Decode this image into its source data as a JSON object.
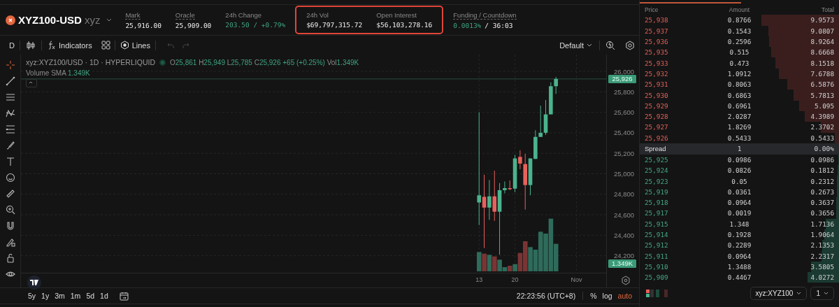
{
  "header": {
    "symbol": "XYZ100-USD",
    "dex": "xyz",
    "groups": [
      {
        "boxed": false,
        "stats": [
          {
            "label": "Mark",
            "value": "25,916.00",
            "underlined": true,
            "positive": false
          },
          {
            "label": "Oracle",
            "value": "25,909.00",
            "underlined": true,
            "positive": false
          },
          {
            "label": "24h Change",
            "value": "203.50 / +0.79%",
            "underlined": false,
            "positive": true
          }
        ]
      },
      {
        "boxed": true,
        "stats": [
          {
            "label": "24h Vol",
            "value": "$69,797,315.72",
            "underlined": false,
            "positive": false
          },
          {
            "label": "Open Interest",
            "value": "$56,103,278.16",
            "underlined": false,
            "positive": false
          }
        ]
      },
      {
        "boxed": false,
        "stats": [
          {
            "label": "Funding / Countdown",
            "value": "0.0013%",
            "value_2": "/ 36:03",
            "underlined": true,
            "positive": true
          }
        ]
      }
    ]
  },
  "toolbar": {
    "interval": "D",
    "indicators": "Indicators",
    "lines": "Lines",
    "layout": "Default"
  },
  "legend": {
    "title": "xyz:XYZ100/USD · 1D · HYPERLIQUID",
    "ohlc": [
      {
        "label": "O",
        "value": "25,861"
      },
      {
        "label": "H",
        "value": "25,949"
      },
      {
        "label": "L",
        "value": "25,785"
      },
      {
        "label": "C",
        "value": "25,926"
      }
    ],
    "change": "+65 (+0.25%)",
    "vol_label": "Vol",
    "vol_value": "1.349K",
    "sma_label": "Volume SMA",
    "sma_value": "1.349K"
  },
  "axis": {
    "price_tag": "25,926",
    "volume_tag": "1.349K",
    "chart_data": {
      "type": "candlestick",
      "x": [
        13,
        14,
        15,
        16,
        17,
        18,
        19,
        20,
        21,
        22,
        23,
        24,
        25,
        26,
        27,
        28
      ],
      "ohlc": [
        [
          24720,
          25600,
          24500,
          24790
        ],
        [
          24775,
          24990,
          24275,
          24670
        ],
        [
          24670,
          24940,
          24550,
          24780
        ],
        [
          24780,
          25030,
          24540,
          24630
        ],
        [
          24630,
          24910,
          24210,
          24840
        ],
        [
          24840,
          24925,
          24810,
          24860
        ],
        [
          24860,
          24935,
          24840,
          24850
        ],
        [
          24855,
          25185,
          24820,
          25150
        ],
        [
          25165,
          25230,
          25045,
          25100
        ],
        [
          25095,
          25195,
          24650,
          24890
        ],
        [
          24890,
          25150,
          24790,
          25150
        ],
        [
          25145,
          25425,
          25145,
          25360
        ],
        [
          25360,
          25665,
          25360,
          25400
        ],
        [
          25400,
          25720,
          25380,
          25580
        ],
        [
          25580,
          25893,
          25580,
          25855
        ],
        [
          25855,
          25945,
          25780,
          25926
        ]
      ],
      "xlim": [
        -76.4,
        37.8
      ],
      "ylim": [
        24034,
        26164
      ],
      "grid": true,
      "ref_lines": [
        {
          "axis": "y",
          "value": 25926
        }
      ],
      "xticks": [
        {
          "value": 13,
          "label": "13"
        },
        {
          "value": 20,
          "label": "20"
        },
        {
          "value": 32,
          "label": "Nov"
        }
      ],
      "yticks": [
        {
          "value": 26000,
          "label": "26,000"
        },
        {
          "value": 25800,
          "label": "25,800"
        },
        {
          "value": 25600,
          "label": "25,600"
        },
        {
          "value": 25400,
          "label": "25,400"
        },
        {
          "value": 25200,
          "label": "25,200"
        },
        {
          "value": 25000,
          "label": "25,000"
        },
        {
          "value": 24800,
          "label": "24,800"
        },
        {
          "value": 24600,
          "label": "24,600"
        },
        {
          "value": 24400,
          "label": "24,400"
        },
        {
          "value": 24200,
          "label": "24,200"
        }
      ]
    }
  },
  "range_bar": {
    "timeframes": [
      "5y",
      "1y",
      "3m",
      "1m",
      "5d",
      "1d"
    ],
    "time": "22:23:56 (UTC+8)",
    "scale_options": [
      {
        "label": "%",
        "selected": false
      },
      {
        "label": "log",
        "selected": false
      },
      {
        "label": "auto",
        "selected": true
      }
    ]
  },
  "order_book": {
    "columns": [
      "Price",
      "Amount",
      "Total"
    ],
    "asks": [
      {
        "price": "25,938",
        "amount": "0.8766",
        "total": "9.9573"
      },
      {
        "price": "25,937",
        "amount": "0.1543",
        "total": "9.0807"
      },
      {
        "price": "25,936",
        "amount": "0.2596",
        "total": "8.9264"
      },
      {
        "price": "25,935",
        "amount": "0.515",
        "total": "8.6668"
      },
      {
        "price": "25,933",
        "amount": "0.473",
        "total": "8.1518"
      },
      {
        "price": "25,932",
        "amount": "1.0912",
        "total": "7.6788"
      },
      {
        "price": "25,931",
        "amount": "0.8063",
        "total": "6.5876"
      },
      {
        "price": "25,930",
        "amount": "0.6863",
        "total": "5.7813"
      },
      {
        "price": "25,929",
        "amount": "0.6961",
        "total": "5.095"
      },
      {
        "price": "25,928",
        "amount": "2.0287",
        "total": "4.3989"
      },
      {
        "price": "25,927",
        "amount": "1.8269",
        "total": "2.3702"
      },
      {
        "price": "25,926",
        "amount": "0.5433",
        "total": "0.5433"
      }
    ],
    "spread": {
      "label": "Spread",
      "value": "1",
      "percent": "0.00%"
    },
    "bids": [
      {
        "price": "25,925",
        "amount": "0.0986",
        "total": "0.0986"
      },
      {
        "price": "25,924",
        "amount": "0.0826",
        "total": "0.1812"
      },
      {
        "price": "25,923",
        "amount": "0.05",
        "total": "0.2312"
      },
      {
        "price": "25,919",
        "amount": "0.0361",
        "total": "0.2673"
      },
      {
        "price": "25,918",
        "amount": "0.0964",
        "total": "0.3637"
      },
      {
        "price": "25,917",
        "amount": "0.0019",
        "total": "0.3656"
      },
      {
        "price": "25,915",
        "amount": "1.348",
        "total": "1.7136"
      },
      {
        "price": "25,914",
        "amount": "0.1928",
        "total": "1.9064"
      },
      {
        "price": "25,912",
        "amount": "0.2289",
        "total": "2.1353"
      },
      {
        "price": "25,911",
        "amount": "0.0964",
        "total": "2.2317"
      },
      {
        "price": "25,910",
        "amount": "1.3488",
        "total": "3.5805"
      },
      {
        "price": "25,909",
        "amount": "0.4467",
        "total": "4.0272"
      }
    ],
    "symbol_select": "xyz:XYZ100",
    "size_select": "1"
  }
}
